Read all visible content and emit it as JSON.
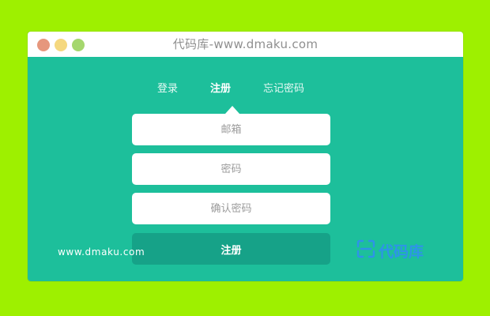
{
  "window": {
    "title": "代码库-www.dmaku.com",
    "traffic_lights": [
      "close",
      "minimize",
      "maximize"
    ]
  },
  "tabs": [
    {
      "label": "登录",
      "active": false
    },
    {
      "label": "注册",
      "active": true
    },
    {
      "label": "忘记密码",
      "active": false
    }
  ],
  "form": {
    "email_placeholder": "邮箱",
    "password_placeholder": "密码",
    "confirm_placeholder": "确认密码",
    "submit_label": "注册"
  },
  "footer": {
    "domain": "www.dmaku.com",
    "logo_text": "代码库"
  },
  "colors": {
    "page_background": "#9ef000",
    "panel": "#1dbf9b",
    "button": "#16a288",
    "logo": "#2e93e8"
  }
}
